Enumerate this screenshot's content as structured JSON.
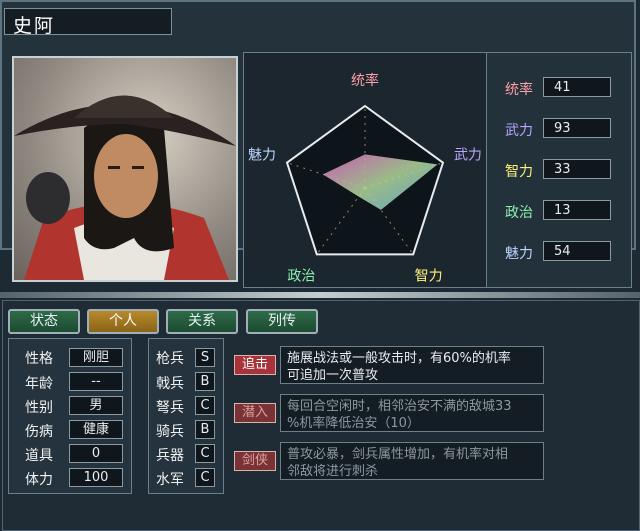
{
  "header": {
    "name": "史阿"
  },
  "radar": {
    "axes": [
      "统率",
      "武力",
      "智力",
      "政治",
      "魅力"
    ],
    "values": [
      41,
      93,
      33,
      13,
      54
    ],
    "max": 100,
    "colors": {
      "lead": "#ff9fa8",
      "war": "#b8a4ff",
      "int": "#fff17a",
      "pol": "#8bf0b0",
      "cha": "#bcd4ff"
    }
  },
  "stats": [
    {
      "label": "统率",
      "value": "41",
      "color": "#ff9fa8"
    },
    {
      "label": "武力",
      "value": "93",
      "color": "#b8a4ff"
    },
    {
      "label": "智力",
      "value": "33",
      "color": "#fff17a"
    },
    {
      "label": "政治",
      "value": "13",
      "color": "#8bf0b0"
    },
    {
      "label": "魅力",
      "value": "54",
      "color": "#bcd4ff"
    }
  ],
  "tabs": [
    "状态",
    "个人",
    "关系",
    "列传"
  ],
  "active_tab": "个人",
  "info": [
    {
      "label": "性格",
      "value": "刚胆"
    },
    {
      "label": "年龄",
      "value": "--"
    },
    {
      "label": "性别",
      "value": "男"
    },
    {
      "label": "伤病",
      "value": "健康"
    },
    {
      "label": "道具",
      "value": "0"
    },
    {
      "label": "体力",
      "value": "100"
    }
  ],
  "troops": [
    {
      "label": "枪兵",
      "grade": "S"
    },
    {
      "label": "戟兵",
      "grade": "B"
    },
    {
      "label": "弩兵",
      "grade": "C"
    },
    {
      "label": "骑兵",
      "grade": "B"
    },
    {
      "label": "兵器",
      "grade": "C"
    },
    {
      "label": "水军",
      "grade": "C"
    }
  ],
  "skills": [
    {
      "name": "追击",
      "desc_line1": "施展战法或一般攻击时，有60%的机率",
      "desc_line2": "可追加一次普攻",
      "enabled": true
    },
    {
      "name": "潜入",
      "desc_line1": "每回合空闲时，相邻治安不满的敌城33",
      "desc_line2": "%机率降低治安（10）",
      "enabled": false
    },
    {
      "name": "剑侠",
      "desc_line1": "普攻必暴，剑兵属性增加，有机率对相",
      "desc_line2": "邻敌将进行刺杀",
      "enabled": false
    }
  ]
}
